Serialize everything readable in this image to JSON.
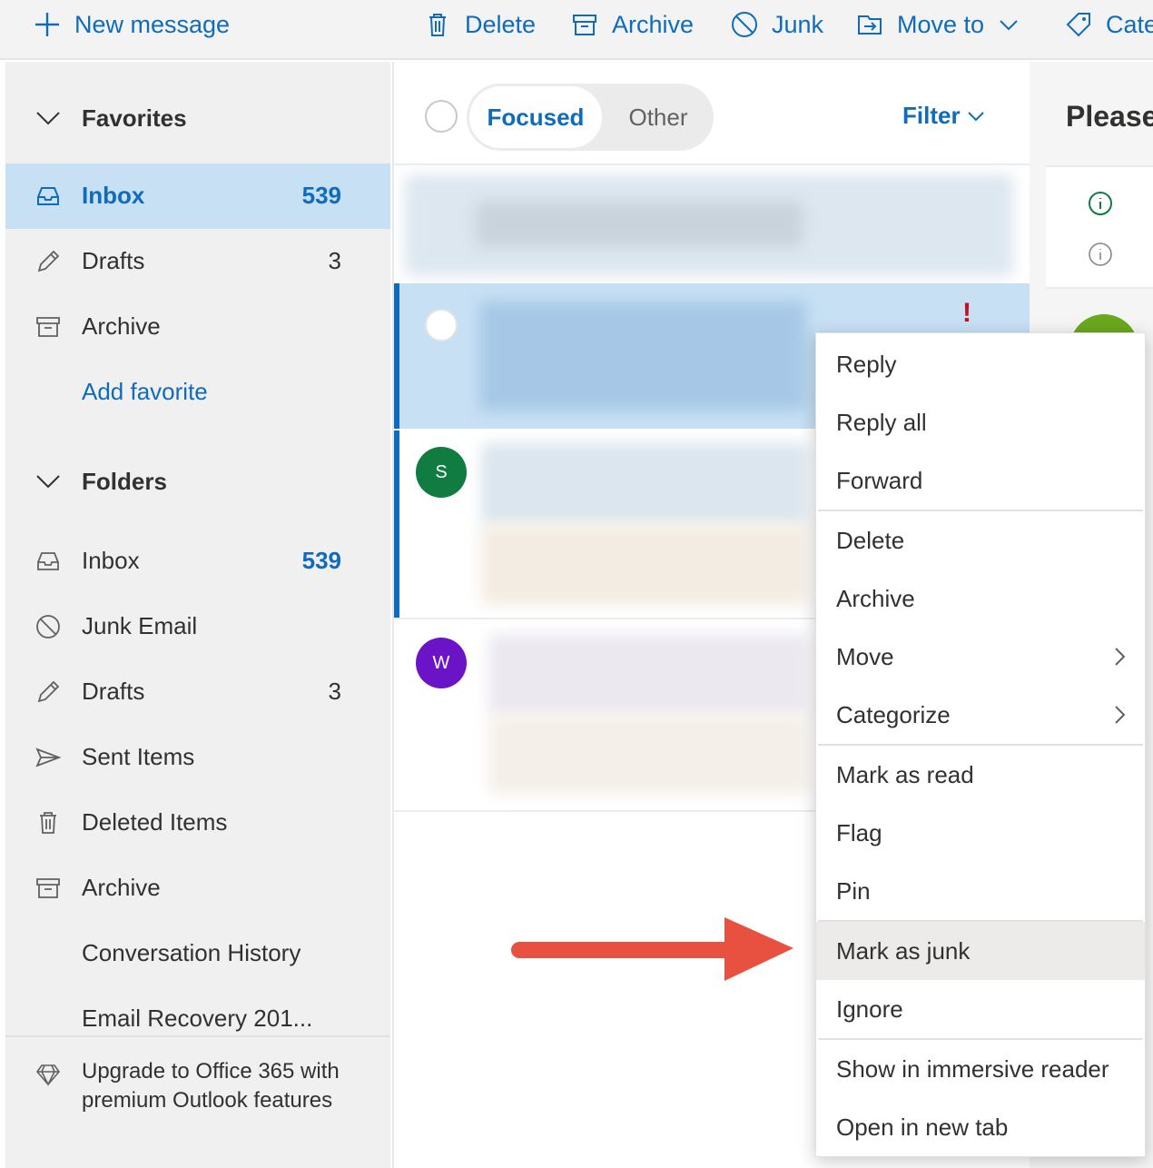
{
  "toolbar": {
    "new_message": "New message",
    "delete": "Delete",
    "archive": "Archive",
    "junk": "Junk",
    "move_to": "Move to",
    "categorize": "Cate"
  },
  "sidebar": {
    "favorites": {
      "header": "Favorites",
      "items": [
        {
          "label": "Inbox",
          "count": "539",
          "icon": "inbox-icon"
        },
        {
          "label": "Drafts",
          "count": "3",
          "icon": "pencil-icon"
        },
        {
          "label": "Archive",
          "count": "",
          "icon": "archive-icon"
        },
        {
          "label": "Add favorite",
          "count": "",
          "icon": ""
        }
      ]
    },
    "folders": {
      "header": "Folders",
      "items": [
        {
          "label": "Inbox",
          "count": "539",
          "icon": "inbox-icon"
        },
        {
          "label": "Junk Email",
          "count": "",
          "icon": "block-icon"
        },
        {
          "label": "Drafts",
          "count": "3",
          "icon": "pencil-icon"
        },
        {
          "label": "Sent Items",
          "count": "",
          "icon": "send-icon"
        },
        {
          "label": "Deleted Items",
          "count": "",
          "icon": "trash-icon"
        },
        {
          "label": "Archive",
          "count": "",
          "icon": "archive-icon"
        },
        {
          "label": "Conversation History",
          "count": "",
          "icon": ""
        },
        {
          "label": "Email Recovery 201...",
          "count": "",
          "icon": ""
        }
      ]
    },
    "upgrade": "Upgrade to Office 365 with premium Outlook features"
  },
  "message_list": {
    "tabs": {
      "focused": "Focused",
      "other": "Other"
    },
    "filter": "Filter",
    "messages": [
      {
        "avatar_letter": "",
        "avatar_color": ""
      },
      {
        "avatar_letter": "",
        "avatar_color": "",
        "important_mark": "!"
      },
      {
        "avatar_letter": "S",
        "avatar_color": "#107c41"
      },
      {
        "avatar_letter": "W",
        "avatar_color": "#6b14c7"
      }
    ]
  },
  "reading_pane": {
    "title": "Please"
  },
  "context_menu": {
    "items": [
      {
        "label": "Reply"
      },
      {
        "label": "Reply all"
      },
      {
        "label": "Forward"
      },
      {
        "label": "Delete"
      },
      {
        "label": "Archive"
      },
      {
        "label": "Move",
        "submenu": true
      },
      {
        "label": "Categorize",
        "submenu": true
      },
      {
        "label": "Mark as read"
      },
      {
        "label": "Flag"
      },
      {
        "label": "Pin"
      },
      {
        "label": "Mark as junk",
        "highlighted": true
      },
      {
        "label": "Ignore"
      },
      {
        "label": "Show in immersive reader"
      },
      {
        "label": "Open in new tab"
      }
    ]
  },
  "colors": {
    "accent": "#0f6cbd",
    "selected_bg": "#c7e0f4",
    "arrow": "#e8503f"
  }
}
